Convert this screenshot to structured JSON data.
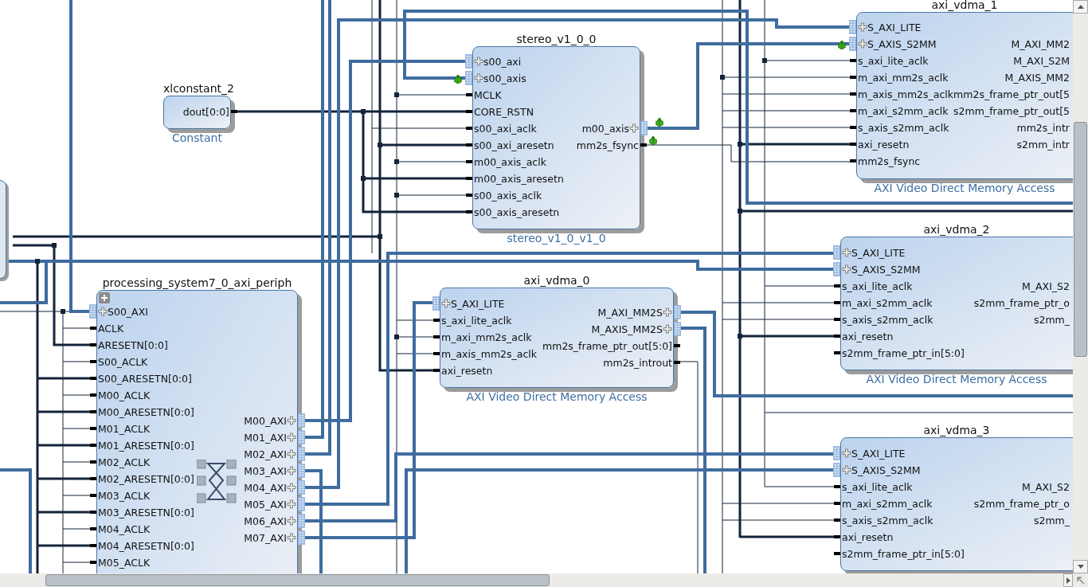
{
  "blocks": [
    {
      "name": "xlconstant_2",
      "subtitle": "Constant",
      "kind": "ip",
      "right": [
        {
          "label": "dout[0:0]",
          "kind": "wire",
          "debug": false
        }
      ]
    },
    {
      "name": "stereo_v1_0_0",
      "subtitle": "stereo_v1_0_v1_0",
      "kind": "ip",
      "left": [
        {
          "label": "s00_axi",
          "kind": "bus",
          "debug": false
        },
        {
          "label": "s00_axis",
          "kind": "bus",
          "debug": true
        },
        {
          "label": "MCLK",
          "kind": "wire",
          "debug": false
        },
        {
          "label": "CORE_RSTN",
          "kind": "wire",
          "debug": false
        },
        {
          "label": "s00_axi_aclk",
          "kind": "wire",
          "debug": false
        },
        {
          "label": "s00_axi_aresetn",
          "kind": "wire",
          "debug": false
        },
        {
          "label": "m00_axis_aclk",
          "kind": "wire",
          "debug": false
        },
        {
          "label": "m00_axis_aresetn",
          "kind": "wire",
          "debug": false
        },
        {
          "label": "s00_axis_aclk",
          "kind": "wire",
          "debug": false
        },
        {
          "label": "s00_axis_aresetn",
          "kind": "wire",
          "debug": false
        }
      ],
      "right": [
        {
          "label": "m00_axis",
          "kind": "bus",
          "debug": true
        },
        {
          "label": "mm2s_fsync",
          "kind": "wire",
          "debug": true
        }
      ]
    },
    {
      "name": "axi_vdma_1",
      "subtitle": "AXI Video Direct Memory Access",
      "kind": "ip",
      "left": [
        {
          "label": "S_AXI_LITE",
          "kind": "bus",
          "debug": false
        },
        {
          "label": "S_AXIS_S2MM",
          "kind": "bus",
          "debug": true
        },
        {
          "label": "s_axi_lite_aclk",
          "kind": "wire",
          "debug": false
        },
        {
          "label": "m_axi_mm2s_aclk",
          "kind": "wire",
          "debug": false
        },
        {
          "label": "m_axis_mm2s_aclk",
          "kind": "wire",
          "debug": false
        },
        {
          "label": "m_axi_s2mm_aclk",
          "kind": "wire",
          "debug": false
        },
        {
          "label": "s_axis_s2mm_aclk",
          "kind": "wire",
          "debug": false
        },
        {
          "label": "axi_resetn",
          "kind": "wire",
          "debug": false
        },
        {
          "label": "mm2s_fsync",
          "kind": "wire",
          "debug": false
        }
      ],
      "right": [
        {
          "label": "M_AXI_MM2",
          "kind": "partial",
          "debug": false
        },
        {
          "label": "M_AXI_S2M",
          "kind": "partial",
          "debug": false
        },
        {
          "label": "M_AXIS_MM2",
          "kind": "partial",
          "debug": false
        },
        {
          "label": "mm2s_frame_ptr_out[5",
          "kind": "partial",
          "debug": false
        },
        {
          "label": "s2mm_frame_ptr_out[5",
          "kind": "partial",
          "debug": false
        },
        {
          "label": "mm2s_intr",
          "kind": "partial",
          "debug": false
        },
        {
          "label": "s2mm_intr",
          "kind": "partial",
          "debug": false
        }
      ]
    },
    {
      "name": "processing_system7_0_axi_periph",
      "kind": "hierarchy",
      "left": [
        {
          "label": "S00_AXI",
          "kind": "bus",
          "debug": false
        },
        {
          "label": "ACLK",
          "kind": "wire",
          "debug": false
        },
        {
          "label": "ARESETN[0:0]",
          "kind": "wire",
          "debug": false
        },
        {
          "label": "S00_ACLK",
          "kind": "wire",
          "debug": false
        },
        {
          "label": "S00_ARESETN[0:0]",
          "kind": "wire",
          "debug": false
        },
        {
          "label": "M00_ACLK",
          "kind": "wire",
          "debug": false
        },
        {
          "label": "M00_ARESETN[0:0]",
          "kind": "wire",
          "debug": false
        },
        {
          "label": "M01_ACLK",
          "kind": "wire",
          "debug": false
        },
        {
          "label": "M01_ARESETN[0:0]",
          "kind": "wire",
          "debug": false
        },
        {
          "label": "M02_ACLK",
          "kind": "wire",
          "debug": false
        },
        {
          "label": "M02_ARESETN[0:0]",
          "kind": "wire",
          "debug": false
        },
        {
          "label": "M03_ACLK",
          "kind": "wire",
          "debug": false
        },
        {
          "label": "M03_ARESETN[0:0]",
          "kind": "wire",
          "debug": false
        },
        {
          "label": "M04_ACLK",
          "kind": "wire",
          "debug": false
        },
        {
          "label": "M04_ARESETN[0:0]",
          "kind": "wire",
          "debug": false
        },
        {
          "label": "M05_ACLK",
          "kind": "wire",
          "debug": false
        }
      ],
      "right": [
        {
          "label": "M00_AXI",
          "kind": "bus",
          "debug": false
        },
        {
          "label": "M01_AXI",
          "kind": "bus",
          "debug": false
        },
        {
          "label": "M02_AXI",
          "kind": "bus",
          "debug": false
        },
        {
          "label": "M03_AXI",
          "kind": "bus",
          "debug": false
        },
        {
          "label": "M04_AXI",
          "kind": "bus",
          "debug": false
        },
        {
          "label": "M05_AXI",
          "kind": "bus",
          "debug": false
        },
        {
          "label": "M06_AXI",
          "kind": "bus",
          "debug": false
        },
        {
          "label": "M07_AXI",
          "kind": "bus",
          "debug": false
        }
      ]
    },
    {
      "name": "axi_vdma_0",
      "subtitle": "AXI Video Direct Memory Access",
      "kind": "ip",
      "left": [
        {
          "label": "S_AXI_LITE",
          "kind": "bus",
          "debug": false
        },
        {
          "label": "s_axi_lite_aclk",
          "kind": "wire",
          "debug": false
        },
        {
          "label": "m_axi_mm2s_aclk",
          "kind": "wire",
          "debug": false
        },
        {
          "label": "m_axis_mm2s_aclk",
          "kind": "wire",
          "debug": false
        },
        {
          "label": "axi_resetn",
          "kind": "wire",
          "debug": false
        }
      ],
      "right": [
        {
          "label": "M_AXI_MM2S",
          "kind": "bus",
          "debug": false
        },
        {
          "label": "M_AXIS_MM2S",
          "kind": "bus",
          "debug": false
        },
        {
          "label": "mm2s_frame_ptr_out[5:0]",
          "kind": "wire",
          "debug": false
        },
        {
          "label": "mm2s_introut",
          "kind": "wire",
          "debug": false
        }
      ]
    },
    {
      "name": "axi_vdma_2",
      "subtitle": "AXI Video Direct Memory Access",
      "kind": "ip",
      "left": [
        {
          "label": "S_AXI_LITE",
          "kind": "bus",
          "debug": false
        },
        {
          "label": "S_AXIS_S2MM",
          "kind": "bus",
          "debug": false
        },
        {
          "label": "s_axi_lite_aclk",
          "kind": "wire",
          "debug": false
        },
        {
          "label": "m_axi_s2mm_aclk",
          "kind": "wire",
          "debug": false
        },
        {
          "label": "s_axis_s2mm_aclk",
          "kind": "wire",
          "debug": false
        },
        {
          "label": "axi_resetn",
          "kind": "wire",
          "debug": false
        },
        {
          "label": "s2mm_frame_ptr_in[5:0]",
          "kind": "wire",
          "debug": false
        }
      ],
      "right": [
        {
          "label": "M_AXI_S2",
          "kind": "partial",
          "debug": false
        },
        {
          "label": "s2mm_frame_ptr_o",
          "kind": "partial",
          "debug": false
        },
        {
          "label": "s2mm_",
          "kind": "partial",
          "debug": false
        }
      ]
    },
    {
      "name": "axi_vdma_3",
      "kind": "ip",
      "left": [
        {
          "label": "S_AXI_LITE",
          "kind": "bus",
          "debug": false
        },
        {
          "label": "S_AXIS_S2MM",
          "kind": "bus",
          "debug": false
        },
        {
          "label": "s_axi_lite_aclk",
          "kind": "wire",
          "debug": false
        },
        {
          "label": "m_axi_s2mm_aclk",
          "kind": "wire",
          "debug": false
        },
        {
          "label": "s_axis_s2mm_aclk",
          "kind": "wire",
          "debug": false
        },
        {
          "label": "axi_resetn",
          "kind": "wire",
          "debug": false
        },
        {
          "label": "s2mm_frame_ptr_in[5:0]",
          "kind": "wire",
          "debug": false
        }
      ],
      "right": [
        {
          "label": "M_AXI_S2",
          "kind": "partial",
          "debug": false
        },
        {
          "label": "s2mm_frame_ptr_o",
          "kind": "partial",
          "debug": false
        },
        {
          "label": "s2mm_",
          "kind": "partial",
          "debug": false
        }
      ]
    }
  ]
}
